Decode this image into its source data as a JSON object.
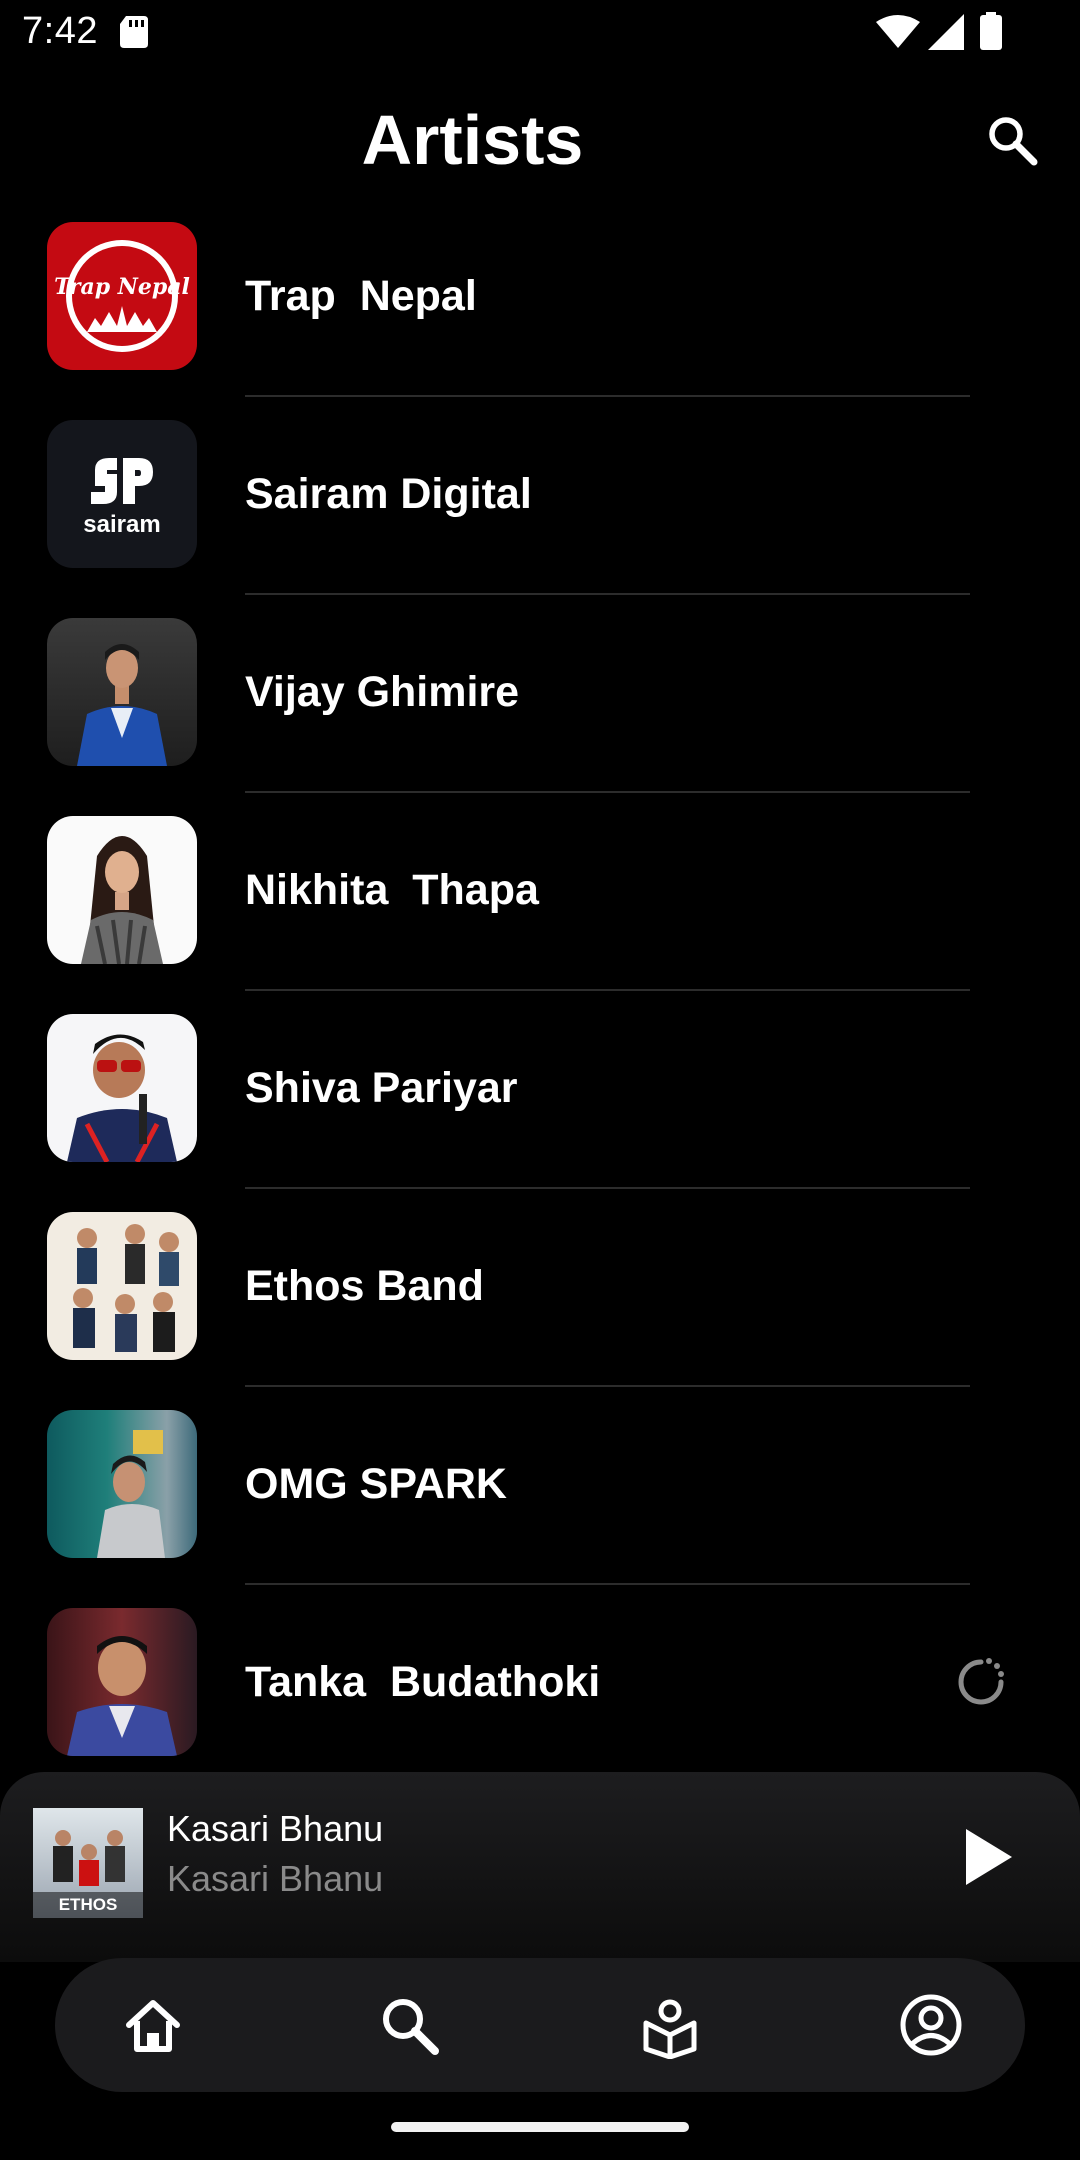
{
  "status_bar": {
    "time": "7:42",
    "icons": [
      "sd-card-icon",
      "wifi-icon",
      "signal-icon",
      "battery-icon"
    ]
  },
  "header": {
    "title": "Artists",
    "search_icon": "search-icon"
  },
  "artists": [
    {
      "name": "Trap  Nepal"
    },
    {
      "name": "Sairam Digital"
    },
    {
      "name": "Vijay Ghimire"
    },
    {
      "name": "Nikhita  Thapa"
    },
    {
      "name": "Shiva Pariyar"
    },
    {
      "name": "Ethos Band"
    },
    {
      "name": "OMG SPARK"
    },
    {
      "name": "Tanka  Budathoki"
    }
  ],
  "thumbnail_text": {
    "trap_nepal_logo": "Trap Nepal",
    "sairam_logo": "sairam",
    "ethos_album": "ETHOS"
  },
  "mini_player": {
    "title": "Kasari Bhanu",
    "artist": "Kasari Bhanu",
    "play_icon": "play-icon"
  },
  "bottom_nav": {
    "items": [
      {
        "icon": "home-icon"
      },
      {
        "icon": "search-icon"
      },
      {
        "icon": "library-icon"
      },
      {
        "icon": "profile-icon"
      }
    ]
  },
  "colors": {
    "background": "#000000",
    "text": "#ffffff",
    "secondary_text": "#8a8a8a",
    "nav_background": "#1b1b1d",
    "trap_nepal_red": "#c40a12"
  }
}
